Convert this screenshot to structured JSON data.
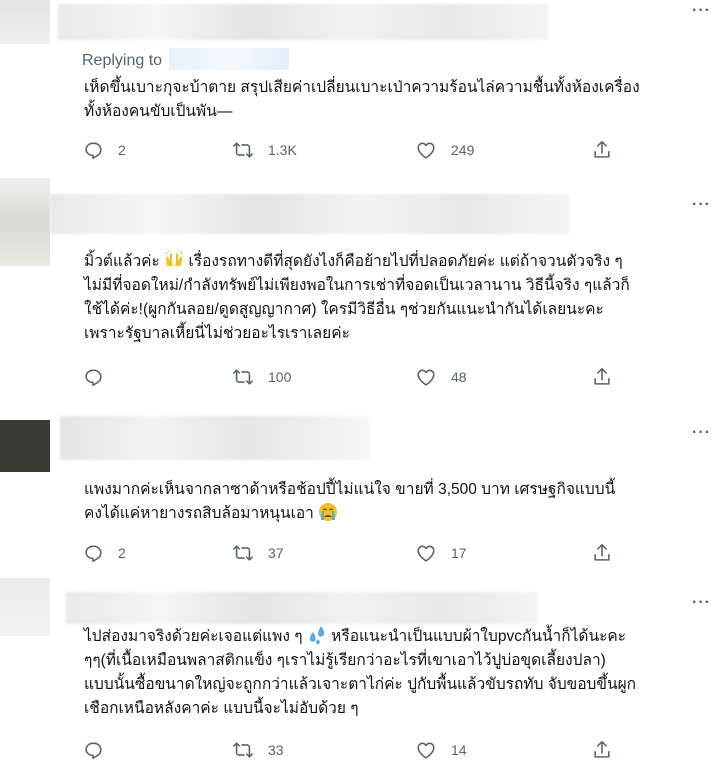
{
  "tweets": [
    {
      "replying_label": "Replying to",
      "text": "เห็ดขึ้นเบาะกุจะบ้าตาย สรุปเสียค่าเปลี่ยนเบาะเป่าความร้อนไล่ความชื้นทั้งห้องเครื่อง\nทั้งห้องคนขับเป็นพัน—",
      "replies": "2",
      "retweets": "1.3K",
      "likes": "249"
    },
    {
      "text_before": "มิ้วต์แล้วค่ะ ",
      "emoji": "raising-hands-emoji",
      "text": " เรื่องรถทางดีที่สุดยังไงก็คือย้ายไปที่ปลอดภัยค่ะ แต่ถ้าจวนตัวจริง ๆ\nไม่มีที่จอดใหม่/กำลังทรัพย์ไม่เพียงพอในการเช่าที่จอดเป็นเวลานาน วิธีนี้จริง ๆแล้วก็\nใช้ได้ค่ะ!(ผูกกันลอย/ดูดสูญญากาศ) ใครมีวิธีอื่น ๆช่วยกันแนะนำกันได้เลยนะคะ\nเพราะรัฐบาลเหี้ยนี่ไม่ช่วยอะไรเราเลยค่ะ",
      "replies": "",
      "retweets": "100",
      "likes": "48"
    },
    {
      "text": "แพงมากค่ะเห็นจากลาซาด้าหรือช้อปปี้ไม่แน่ใจ ขายที่ 3,500 บาท เศรษฐกิจแบบนี้\nคงได้แค่หายางรถสิบล้อมาหนุนเอา ",
      "emoji": "crying-face-emoji",
      "replies": "2",
      "retweets": "37",
      "likes": "17"
    },
    {
      "text_before": "ไปส่องมาจริงด้วยค่ะเจอแต่แพง ๆ ",
      "emoji": "sweat-droplets-emoji",
      "text": " หรือแนะนำเป็นแบบผ้าใบpvcกันน้ำก็ได้นะคะ\nๆๆ(ที่เนื้อเหมือนพลาสติกแข็ง ๆเราไม่รู้เรียกว่าอะไรที่เขาเอาไว้ปูบ่อขุดเลี้ยงปลา)\nแบบนั้นซื้อขนาดใหญ่จะถูกกว่าแล้วเจาะตาไก่ค่ะ ปูกับพื้นแล้วขับรถทับ จับขอบขึ้นผูก\nเชือกเหนือหลังคาค่ะ แบบนี้จะไม่อับด้วย ๆ",
      "replies": "",
      "retweets": "33",
      "likes": "14"
    }
  ],
  "more_glyph": "···",
  "colors": {
    "text": "#0f1419",
    "muted": "#536471",
    "divider": "#eff3f4"
  }
}
